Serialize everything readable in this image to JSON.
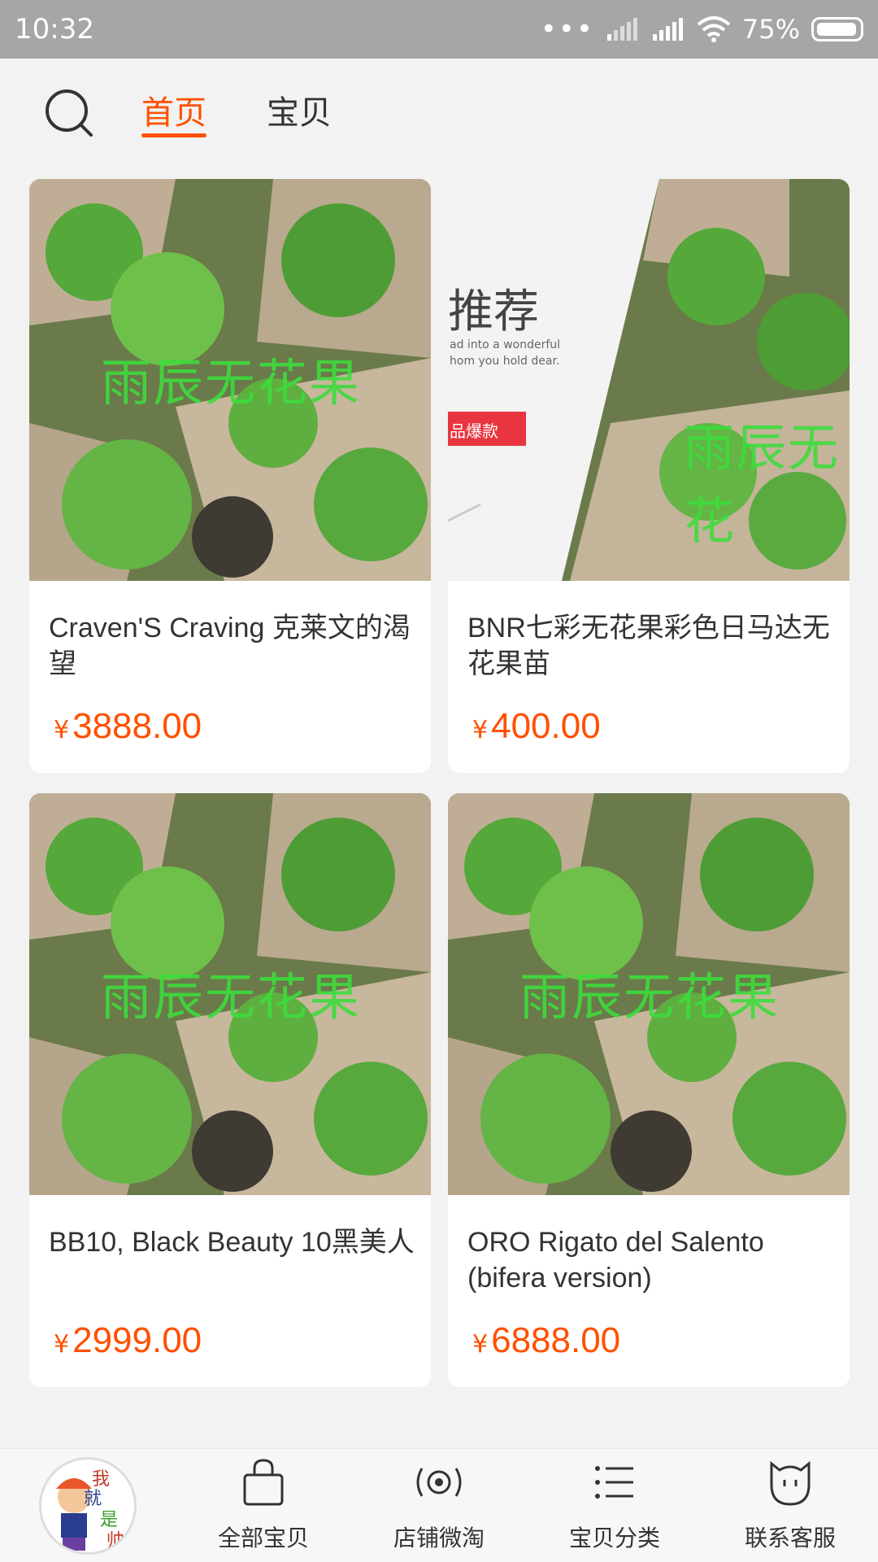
{
  "status_bar": {
    "time": "10:32",
    "battery_percent": "75%",
    "battery_level": 0.75
  },
  "top_tabs": [
    {
      "label": "首页",
      "active": true
    },
    {
      "label": "宝贝",
      "active": false
    }
  ],
  "products": [
    {
      "title": "Craven'S Craving 克莱文的渴望",
      "currency": "¥",
      "price": "3888.00",
      "watermark": "雨辰无花果"
    },
    {
      "title": "BNR七彩无花果彩色日马达无花果苗",
      "currency": "¥",
      "price": "400.00",
      "watermark": "雨辰无花",
      "banner_text": "推荐",
      "banner_sub1": "ad into a wonderful",
      "banner_sub2": "hom you hold dear.",
      "banner_tag": "品爆款"
    },
    {
      "title": "BB10, Black Beauty 10黑美人",
      "currency": "¥",
      "price": "2999.00",
      "watermark": "雨辰无花果"
    },
    {
      "title": "ORO Rigato del Salento (bifera version)",
      "currency": "¥",
      "price": "6888.00",
      "watermark": "雨辰无花果"
    }
  ],
  "bottom_nav": {
    "logo_text": [
      "我",
      "就",
      "是",
      "帅"
    ],
    "items": [
      {
        "label": "全部宝贝",
        "icon": "shopping-bag-icon"
      },
      {
        "label": "店铺微淘",
        "icon": "broadcast-icon"
      },
      {
        "label": "宝贝分类",
        "icon": "list-icon"
      },
      {
        "label": "联系客服",
        "icon": "chat-face-icon"
      }
    ]
  },
  "colors": {
    "accent": "#ff5000",
    "watermark": "#3ddc3d",
    "status_bar": "#a6a6a6"
  }
}
